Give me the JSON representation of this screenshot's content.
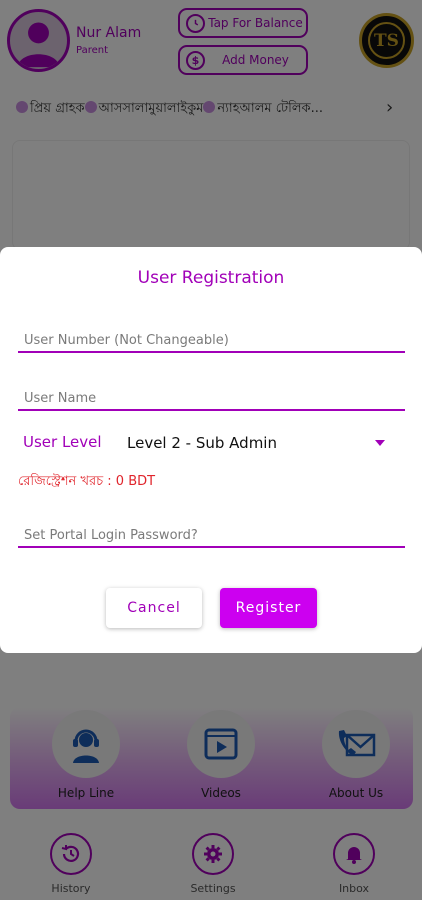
{
  "header": {
    "user_name": "Nur Alam",
    "user_role": "Parent",
    "balance_button": "Tap For Balance",
    "add_money_button": "Add Money",
    "logo_text": "TS"
  },
  "marquee": {
    "text": "প্রিয় গ্রাহক আসসালামুয়ালাইকুম ন্যাহআলম টেলিক...",
    "segments": [
      "প্রিয় গ্রাহক",
      "আসসালামুয়ালাইকুম",
      "ন্যাহআলম টেলিক..."
    ]
  },
  "features": {
    "help_line": "Help Line",
    "videos": "Videos",
    "about_us": "About Us"
  },
  "bottom_nav": {
    "history": "History",
    "settings": "Settings",
    "inbox": "Inbox"
  },
  "dialog": {
    "title": "User Registration",
    "user_number_placeholder": "User Number (Not Changeable)",
    "user_name_placeholder": "User Name",
    "user_level_label": "User Level",
    "user_level_value": "Level 2 - Sub Admin",
    "registration_cost": "রেজিস্ট্রেশন খরচ : 0 BDT",
    "password_placeholder": "Set Portal Login Password?",
    "cancel_label": "Cancel",
    "register_label": "Register"
  },
  "colors": {
    "accent": "#a100b8",
    "register_button": "#cc00f0",
    "error_text": "#e0242b",
    "scrim": "rgba(0,0,0,0.5)"
  },
  "icons": [
    "person-icon",
    "clock-icon",
    "dollar-icon",
    "logo-emblem",
    "chevron-right-icon",
    "headset-icon",
    "video-icon",
    "mail-phone-icon",
    "history-icon",
    "gear-icon",
    "bell-icon",
    "dropdown-caret-icon"
  ]
}
